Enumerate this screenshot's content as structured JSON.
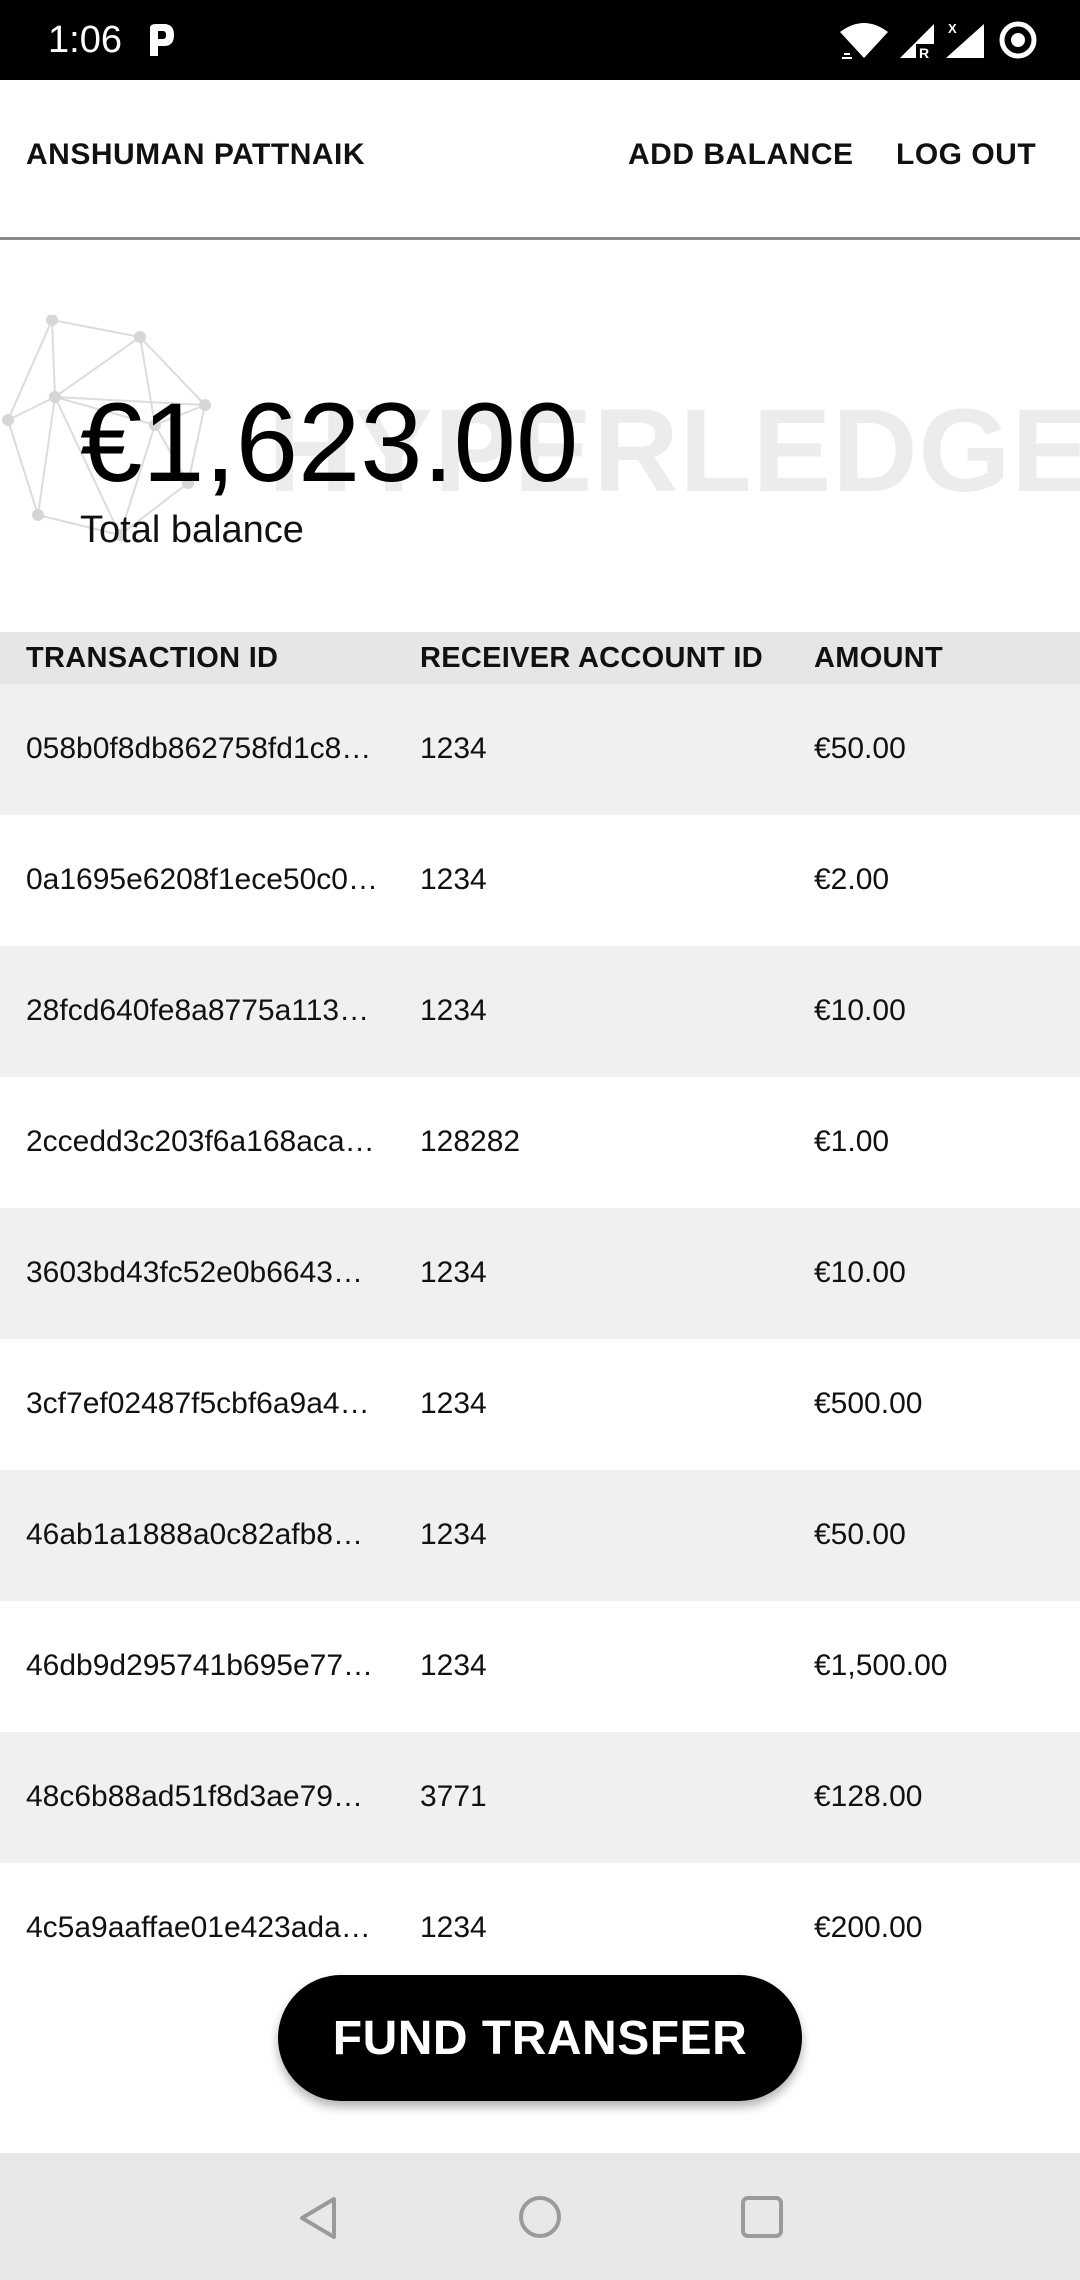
{
  "status_bar": {
    "time": "1:06",
    "icons": [
      "pocket-p-icon",
      "wifi-icon",
      "signal-r-icon",
      "signal-x-icon",
      "sync-icon"
    ]
  },
  "app_bar": {
    "user_name": "ANSHUMAN PATTNAIK",
    "add_balance_label": "ADD BALANCE",
    "logout_label": "LOG OUT"
  },
  "balance": {
    "amount": "€1,623.00",
    "label": "Total balance",
    "watermark": "HYPERLEDGER"
  },
  "table": {
    "headers": [
      "TRANSACTION ID",
      "RECEIVER ACCOUNT ID",
      "AMOUNT"
    ],
    "rows": [
      {
        "tx": "058b0f8db862758fd1c8…",
        "receiver": "1234",
        "amount": "€50.00"
      },
      {
        "tx": "0a1695e6208f1ece50c0…",
        "receiver": "1234",
        "amount": "€2.00"
      },
      {
        "tx": "28fcd640fe8a8775a113…",
        "receiver": "1234",
        "amount": "€10.00"
      },
      {
        "tx": "2ccedd3c203f6a168aca…",
        "receiver": "128282",
        "amount": "€1.00"
      },
      {
        "tx": "3603bd43fc52e0b6643…",
        "receiver": "1234",
        "amount": "€10.00"
      },
      {
        "tx": "3cf7ef02487f5cbf6a9a4…",
        "receiver": "1234",
        "amount": "€500.00"
      },
      {
        "tx": "46ab1a1888a0c82afb8…",
        "receiver": "1234",
        "amount": "€50.00"
      },
      {
        "tx": "46db9d295741b695e77…",
        "receiver": "1234",
        "amount": "€1,500.00"
      },
      {
        "tx": "48c6b88ad51f8d3ae79…",
        "receiver": "3771",
        "amount": "€128.00"
      },
      {
        "tx": "4c5a9aaffae01e423ada…",
        "receiver": "1234",
        "amount": "€200.00"
      }
    ]
  },
  "fab": {
    "label": "FUND TRANSFER"
  },
  "nav_bar": {
    "icons": [
      "back-icon",
      "home-icon",
      "recents-icon"
    ]
  },
  "colors": {
    "primary": "#000000",
    "row_alt": "#f0f0f0",
    "header_bg": "#e6e6e6",
    "watermark": "#ececec",
    "navbar_bg": "#e8e8e8"
  }
}
